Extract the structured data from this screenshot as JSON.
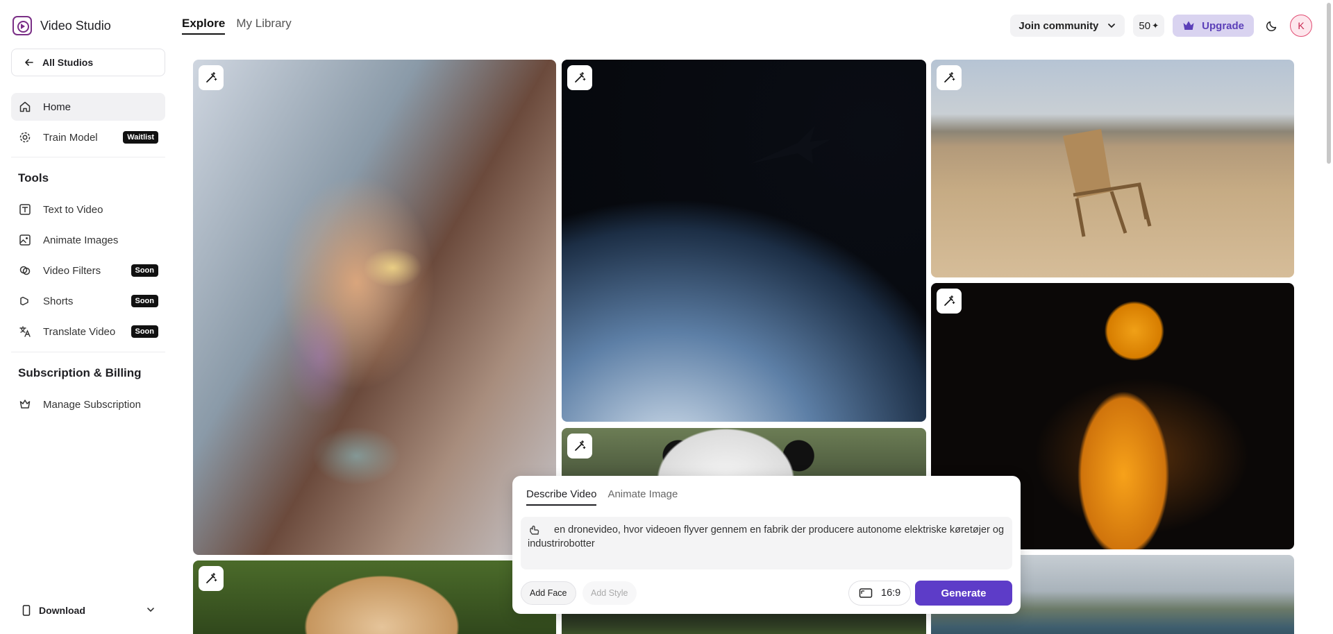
{
  "app": {
    "name": "Video Studio"
  },
  "sidebar": {
    "all_studios": "All Studios",
    "nav": [
      {
        "label": "Home",
        "icon": "home-icon"
      },
      {
        "label": "Train Model",
        "icon": "gear-icon",
        "badge": "Waitlist"
      }
    ],
    "tools_title": "Tools",
    "tools": [
      {
        "label": "Text to Video",
        "icon": "text-video-icon"
      },
      {
        "label": "Animate Images",
        "icon": "image-icon"
      },
      {
        "label": "Video Filters",
        "icon": "filter-icon",
        "badge": "Soon"
      },
      {
        "label": "Shorts",
        "icon": "shorts-icon",
        "badge": "Soon"
      },
      {
        "label": "Translate Video",
        "icon": "translate-icon",
        "badge": "Soon"
      }
    ],
    "billing_title": "Subscription & Billing",
    "billing": [
      {
        "label": "Manage Subscription",
        "icon": "crown-icon"
      }
    ],
    "download": "Download"
  },
  "header": {
    "tabs": [
      "Explore",
      "My Library"
    ],
    "active_tab": "Explore",
    "join_community": "Join community",
    "credits": "50",
    "credits_symbol": "✦",
    "upgrade": "Upgrade",
    "avatar_initial": "K"
  },
  "prompt_panel": {
    "tabs": [
      "Describe Video",
      "Animate Image"
    ],
    "active_tab": "Describe Video",
    "prompt_text": "en dronevideo, hvor videoen flyver gennem en fabrik der producere autonome elektriske køretøjer og industrirobotter",
    "add_face": "Add Face",
    "add_style": "Add Style",
    "aspect_ratio": "16:9",
    "generate": "Generate"
  },
  "colors": {
    "accent": "#5d3cc8",
    "upgrade_bg": "#d9d3f0",
    "brand": "#7a2f86"
  }
}
